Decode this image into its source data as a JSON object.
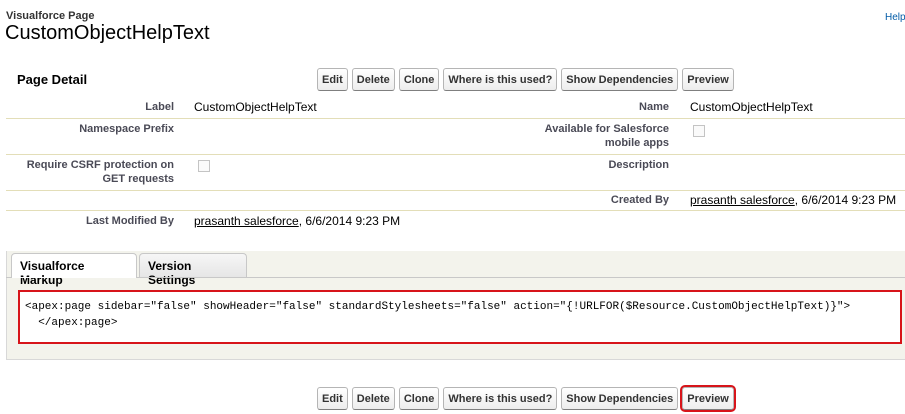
{
  "header": {
    "breadcrumb": "Visualforce Page",
    "title": "CustomObjectHelpText",
    "help_link": "Help"
  },
  "detail": {
    "heading": "Page Detail",
    "buttons": [
      "Edit",
      "Delete",
      "Clone",
      "Where is this used?",
      "Show Dependencies",
      "Preview"
    ],
    "fields": {
      "label_label": "Label",
      "label_value": "CustomObjectHelpText",
      "name_label": "Name",
      "name_value": "CustomObjectHelpText",
      "namespace_label": "Namespace Prefix",
      "namespace_value": "",
      "mobile_label_1": "Available for Salesforce",
      "mobile_label_2": "mobile apps",
      "mobile_checked": false,
      "csrf_label_1": "Require CSRF protection on",
      "csrf_label_2": "GET requests",
      "csrf_checked": false,
      "description_label": "Description",
      "description_value": "",
      "created_by_label": "Created By",
      "created_by_user": "prasanth salesforce",
      "created_by_date": ", 6/6/2014 9:23 PM",
      "modified_by_label": "Last Modified By",
      "modified_by_user": "prasanth salesforce",
      "modified_by_date": ", 6/6/2014 9:23 PM"
    }
  },
  "tabs": [
    {
      "label": "Visualforce Markup",
      "active": true
    },
    {
      "label": "Version Settings",
      "active": false
    }
  ],
  "markup": {
    "line1": "<apex:page sidebar=\"false\" showHeader=\"false\" standardStylesheets=\"false\" action=\"{!URLFOR($Resource.CustomObjectHelpText)}\">",
    "line2": "  </apex:page>"
  },
  "colors": {
    "highlight": "#d7141a",
    "label_text": "#4a4a56",
    "tab_panel_bg": "#f3f3ec",
    "help_link": "#015ba7"
  }
}
